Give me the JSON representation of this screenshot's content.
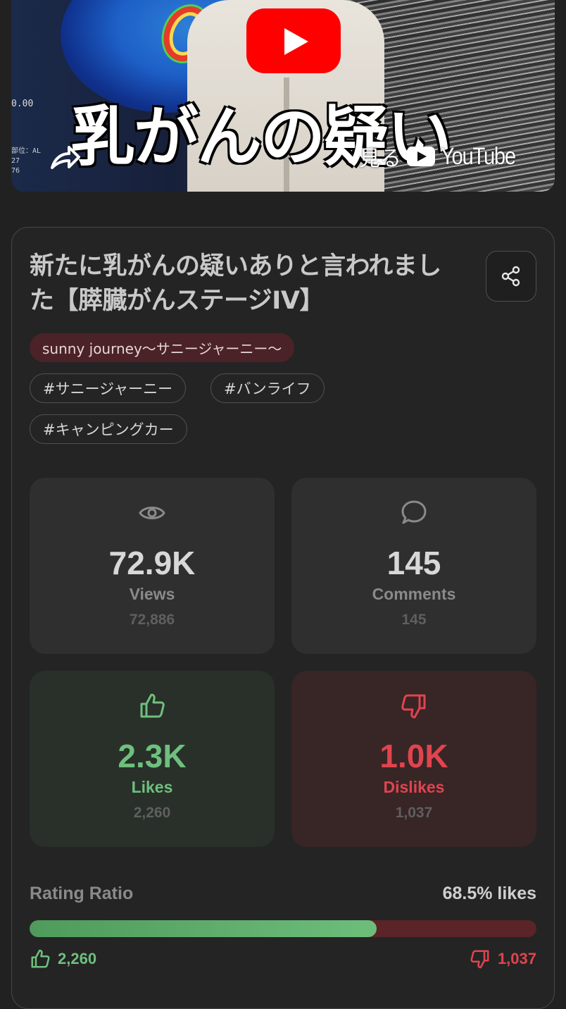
{
  "video": {
    "thumbnail_caption": "乳がんの疑い",
    "watch_on_label": "見る",
    "youtube_wordmark": "YouTube",
    "scan_scale_text": "0.00",
    "scan_small_text": "部位：AL\n27\n76",
    "play_icon": "youtube-play-icon",
    "share_icon": "share-arrow-icon"
  },
  "title": "新たに乳がんの疑いありと言われました【膵臓がんステージIV】",
  "share_button": {
    "icon": "share-nodes-icon"
  },
  "channel": "sunny journey〜サニージャーニー〜",
  "tags": [
    "#サニージャーニー",
    "#バンライフ",
    "#キャンピングカー"
  ],
  "stats": {
    "views": {
      "short": "72.9K",
      "label": "Views",
      "exact": "72,886",
      "icon": "eye-icon"
    },
    "comments": {
      "short": "145",
      "label": "Comments",
      "exact": "145",
      "icon": "comment-icon"
    },
    "likes": {
      "short": "2.3K",
      "label": "Likes",
      "exact": "2,260",
      "icon": "thumbs-up-icon"
    },
    "dislikes": {
      "short": "1.0K",
      "label": "Dislikes",
      "exact": "1,037",
      "icon": "thumbs-down-icon"
    }
  },
  "rating": {
    "label": "Rating Ratio",
    "value_text": "68.5% likes",
    "like_fraction": 0.685,
    "likes": "2,260",
    "dislikes": "1,037"
  },
  "colors": {
    "background": "#212121",
    "like_green": "#6fbf7e",
    "dislike_red": "#e0444e",
    "channel_pill": "#4b2227",
    "youtube_red": "#ff0000"
  }
}
